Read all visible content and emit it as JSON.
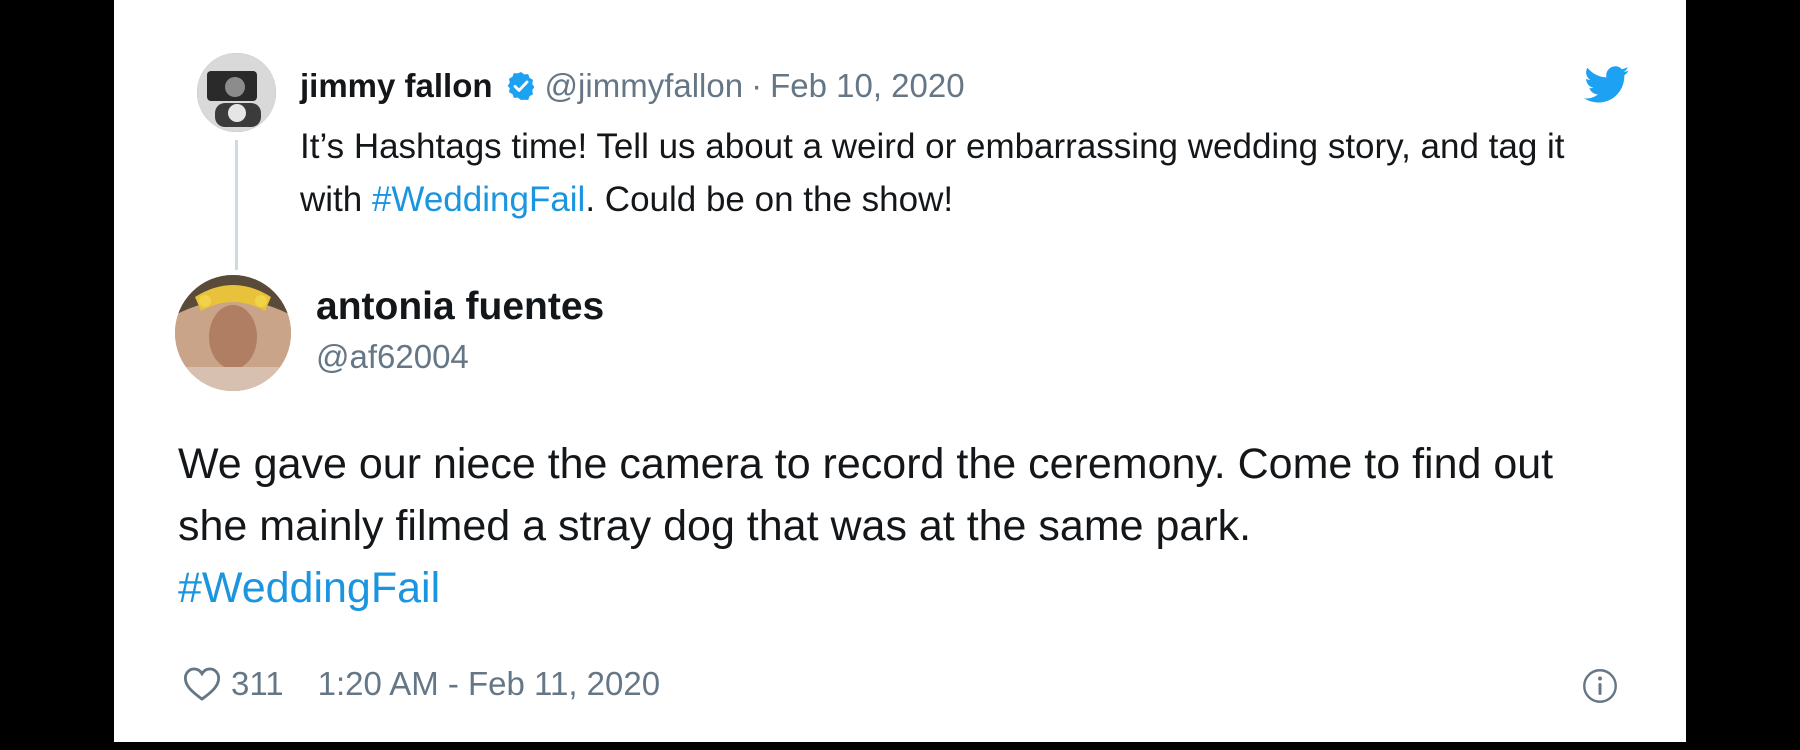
{
  "quoted_tweet": {
    "name": "jimmy fallon",
    "handle": "@jimmyfallon",
    "separator": "·",
    "date": "Feb 10, 2020",
    "text_before": "It’s Hashtags time! Tell us about a weird or embarrassing wedding story, and tag it with ",
    "hashtag": "#WeddingFail",
    "text_after": ". Could be on the show!"
  },
  "tweet": {
    "name": "antonia fuentes",
    "handle": "@af62004",
    "text": "We gave our niece the camera to record the ceremony. Come to find out she mainly filmed a stray dog that was at the same park.",
    "hashtag": "#WeddingFail"
  },
  "footer": {
    "likes": "311",
    "timestamp": "1:20 AM - Feb 11, 2020"
  },
  "colors": {
    "hashtag": "#1b95e0",
    "twitter_blue": "#1da1f2",
    "muted": "#657786",
    "text": "#14171a"
  },
  "icons": [
    "verified-icon",
    "twitter-bird-icon",
    "heart-icon",
    "info-icon"
  ]
}
